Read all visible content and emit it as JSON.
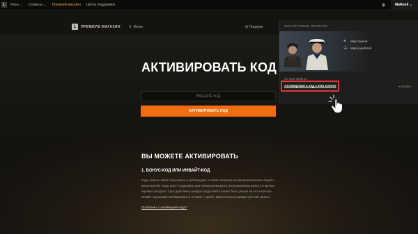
{
  "topbar": {
    "logo_letter": "L",
    "nav": [
      {
        "label": "Игры ⌄",
        "active": false
      },
      {
        "label": "Сервисы ⌄",
        "active": false
      },
      {
        "label": "Премиум магазин",
        "active": true
      },
      {
        "label": "Центр поддержки",
        "active": false
      }
    ],
    "username": "Malkeell ⌄",
    "accent_color": "#e7a43c"
  },
  "subbar": {
    "logo_letter": "L",
    "shop_title": "ПРЕМИУМ МАГАЗИН",
    "menu_label": "Меню",
    "gifts_label": "Подарки"
  },
  "main": {
    "title": "АКТИВИРОВАТЬ КОД",
    "code_placeholder": "ВВЕДИТЕ КОД",
    "activate_button": "АКТИВИРОВАТЬ КОД",
    "button_color": "#f26d10",
    "section_title": "ВЫ МОЖЕТЕ АКТИВИРОВАТЬ",
    "subsection_title": "1. БОНУС-КОД ИЛИ ИНВАЙТ-КОД",
    "paragraph_lines": [
      "Коды можно найти в бросюрах и публикациях, а также получить во время различных акций и",
      "мероприятий. Коды могут содержать дни Премиум аккаунта, внутриигровую валюту и прочие",
      "игровые ресурсы. Срок действия у каждого кода свой и может быть указан на его носителе.",
      "Инвайт-код можно активировать в течение 7 дней с момента регистрации учётной записи."
    ],
    "help_link": "Проблемы с активацией кода?"
  },
  "dropdown": {
    "profiles_heading": "МОИ ИГРОВЫЕ ПРОФИЛИ",
    "tanks_link": "Мир танков",
    "ships_link": "Мир кораблей",
    "cabinet_label": "Личный кабинет",
    "activate_link": "Активировать код Lesta Games",
    "logout_label": "Выйти",
    "highlight_color": "#d93a3d"
  },
  "icons": {
    "bell": "bell-icon",
    "burger": "burger-menu-icon",
    "gift": "gift-icon",
    "tank": "tank-icon",
    "ship": "ship-icon",
    "logout": "logout-icon",
    "cursor": "hand-pointer-icon"
  }
}
